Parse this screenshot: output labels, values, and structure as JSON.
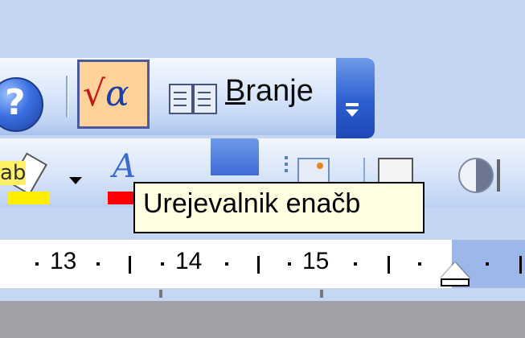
{
  "toolbar_standard": {
    "help_button": {
      "icon": "help-icon",
      "glyph": "?"
    },
    "equation_button": {
      "icon": "equation-editor-icon",
      "glyph_sqrt": "√",
      "glyph_alpha": "α",
      "pressed": true
    },
    "reading_button": {
      "icon": "book-icon",
      "label_underlined": "B",
      "label_rest": "ranje"
    },
    "overflow_button": {
      "icon": "toolbar-options-icon"
    }
  },
  "toolbar_formatting": {
    "highlight_button": {
      "icon": "highlighter-icon",
      "glyph": "ab",
      "color": "#ffee00"
    },
    "highlight_dropdown": {
      "icon": "chevron-down-icon"
    },
    "font_color_button": {
      "icon": "font-color-icon",
      "glyph": "A",
      "color": "#ff0000"
    }
  },
  "tooltip": {
    "text": "Urejevalnik enačb"
  },
  "ruler": {
    "numbers": [
      "13",
      "14",
      "15"
    ]
  }
}
